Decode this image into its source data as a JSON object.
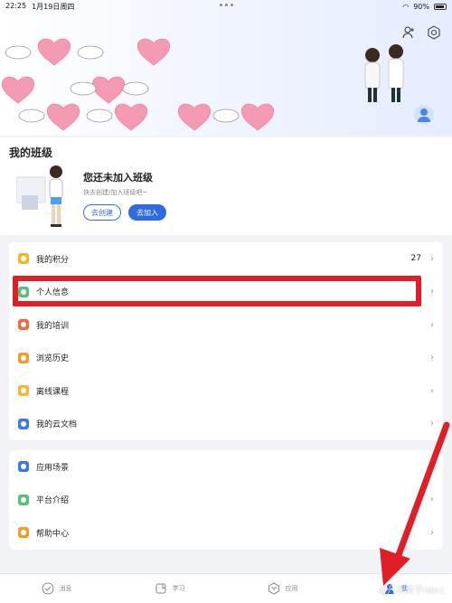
{
  "status": {
    "time": "22:25",
    "date": "1月19日周四",
    "battery": "90%"
  },
  "my_class": {
    "title": "我的班级",
    "card_title": "您还未加入班级",
    "card_sub": "快去创建/加入班级吧~",
    "create_label": "去创建",
    "join_label": "去加入"
  },
  "menu1": [
    {
      "label": "我的积分",
      "value": "27",
      "color": "#f3b52a",
      "icon": "points-icon"
    },
    {
      "label": "个人信息",
      "value": "",
      "color": "#55c07a",
      "icon": "profile-icon"
    },
    {
      "label": "我的培训",
      "value": "",
      "color": "#f26b3c",
      "icon": "training-icon"
    },
    {
      "label": "浏览历史",
      "value": "",
      "color": "#f39b2a",
      "icon": "history-icon"
    },
    {
      "label": "离线课程",
      "value": "",
      "color": "#f6b63a",
      "icon": "offline-course-icon"
    },
    {
      "label": "我的云文档",
      "value": "",
      "color": "#3a7be6",
      "icon": "cloud-doc-icon"
    }
  ],
  "menu2": [
    {
      "label": "应用场景",
      "color": "#3a7be6",
      "icon": "scene-icon"
    },
    {
      "label": "平台介绍",
      "color": "#55c07a",
      "icon": "intro-icon"
    },
    {
      "label": "帮助中心",
      "color": "#f39b2a",
      "icon": "help-icon"
    }
  ],
  "tabs": [
    {
      "label": "消息",
      "icon": "message-icon"
    },
    {
      "label": "学习",
      "icon": "study-icon"
    },
    {
      "label": "应用",
      "icon": "apps-icon"
    },
    {
      "label": "我",
      "icon": "me-icon"
    }
  ],
  "watermark": "@凡夫俗子nbcc"
}
